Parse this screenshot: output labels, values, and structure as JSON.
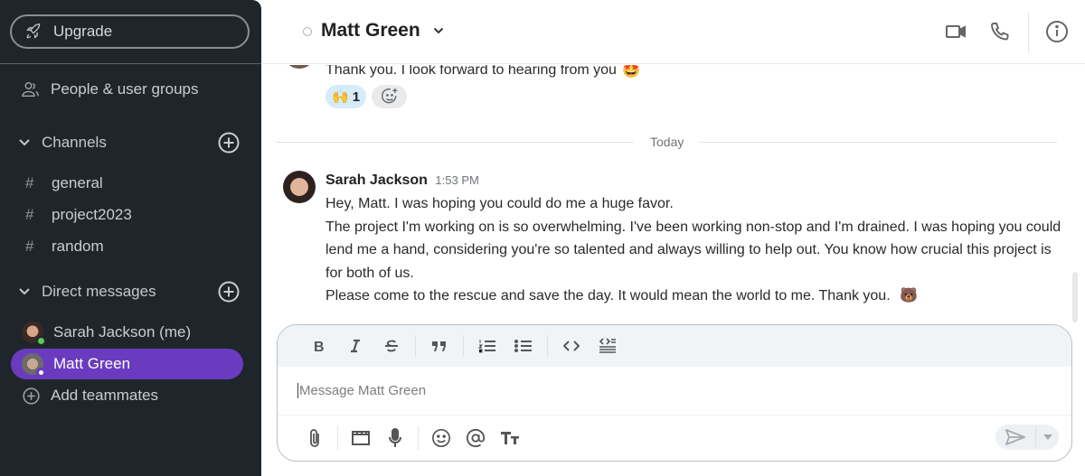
{
  "sidebar": {
    "upgrade_label": "Upgrade",
    "people_label": "People & user groups",
    "channels": {
      "header": "Channels",
      "items": [
        {
          "name": "general"
        },
        {
          "name": "project2023"
        },
        {
          "name": "random"
        }
      ]
    },
    "direct_messages": {
      "header": "Direct messages",
      "items": [
        {
          "name": "Sarah Jackson (me)",
          "status": "online",
          "status_color": "#5cc95c",
          "active": false
        },
        {
          "name": "Matt Green",
          "status": "away",
          "status_color": "#6a3bbf",
          "active": true
        }
      ],
      "add_label": "Add teammates"
    },
    "active_color": "#6a3bbf"
  },
  "header": {
    "title": "Matt Green",
    "icons": [
      "video-icon",
      "phone-icon",
      "info-icon"
    ]
  },
  "messages": {
    "previous": {
      "text": "Thank you. I look forward to hearing from you",
      "emoji": "🤩",
      "reactions": [
        {
          "emoji": "🙌",
          "count": "1"
        }
      ]
    },
    "day_divider": "Today",
    "latest": {
      "sender": "Sarah Jackson",
      "time": "1:53 PM",
      "lines": [
        "Hey, Matt. I was hoping you could do me a huge favor.",
        "The project I'm working on is so overwhelming. I've been working non-stop and I'm drained. I was hoping you could lend me a hand, considering you're so talented and always willing to help out. You know how crucial this project is for both of us.",
        "Please come to the rescue and save the day. It would mean the world to me. Thank you."
      ],
      "trailing_emoji": "🐻"
    }
  },
  "composer": {
    "placeholder": "Message Matt Green",
    "value": "",
    "format_buttons": [
      "bold",
      "italic",
      "strikethrough",
      "quote",
      "numbered-list",
      "bulleted-list",
      "code",
      "code-block"
    ],
    "action_buttons": [
      "attach",
      "video-clip",
      "microphone",
      "emoji",
      "mention",
      "text-format"
    ]
  }
}
